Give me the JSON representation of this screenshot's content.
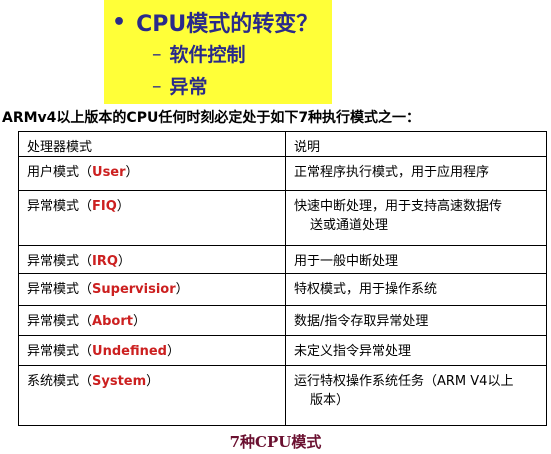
{
  "slide": {
    "bullet": "CPU模式的转变？",
    "sub_items": [
      "软件控制",
      "异常"
    ]
  },
  "intro_text": "ARMv4以上版本的CPU任何时刻必定处于如下7种执行模式之一：",
  "table": {
    "headers": [
      "处理器模式",
      "说明"
    ],
    "rows": [
      {
        "mode_cn": "用户模式（",
        "mode_en": "User",
        "close": "）",
        "desc": "正常程序执行模式，用于应用程序",
        "desc2": ""
      },
      {
        "mode_cn": "异常模式（",
        "mode_en": "FIQ",
        "close": "）",
        "desc": "快速中断处理，用于支持高速数据传",
        "desc2": "送或通道处理"
      },
      {
        "mode_cn": "异常模式（",
        "mode_en": "IRQ",
        "close": "）",
        "desc": "用于一般中断处理",
        "desc2": ""
      },
      {
        "mode_cn": "异常模式（",
        "mode_en": "Supervisior",
        "close": "）",
        "desc": "特权模式，用于操作系统",
        "desc2": ""
      },
      {
        "mode_cn": "异常模式（",
        "mode_en": "Abort",
        "close": "）",
        "desc": "数据/指令存取异常处理",
        "desc2": ""
      },
      {
        "mode_cn": "异常模式（",
        "mode_en": "Undefined",
        "close": "）",
        "desc": "未定义指令异常处理",
        "desc2": ""
      },
      {
        "mode_cn": "系统模式（",
        "mode_en": "System",
        "close": "）",
        "desc": "运行特权操作系统任务（ARM V4以上",
        "desc2": "版本）"
      }
    ]
  },
  "caption": "7种CPU模式",
  "colors": {
    "highlight": "#ffff38",
    "bullet_text": "#2a2a8a",
    "mode_english": "#cc2020",
    "caption": "#6a1030"
  }
}
